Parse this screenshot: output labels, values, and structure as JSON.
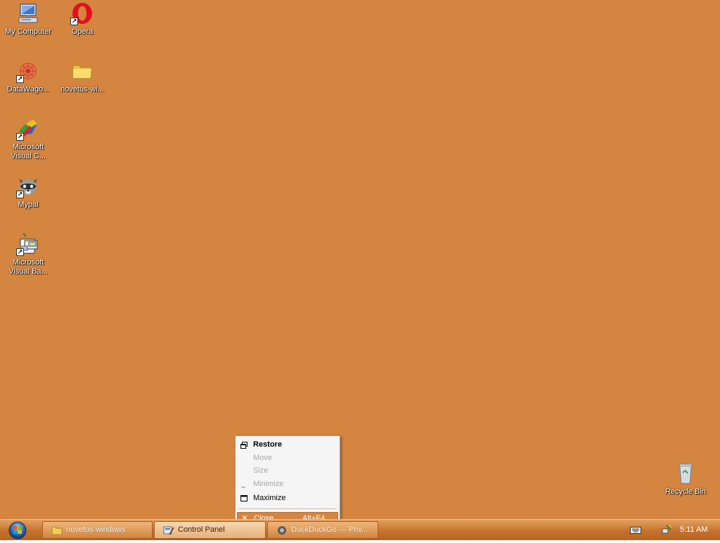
{
  "desktop": {
    "background_color": "#d4853f",
    "icons": [
      {
        "label": "My Computer",
        "icon": "my-computer-icon",
        "shortcut": false
      },
      {
        "label": "Opera",
        "icon": "opera-icon",
        "shortcut": true
      },
      {
        "label": "DataWago...",
        "icon": "datawagon-icon",
        "shortcut": true
      },
      {
        "label": "novetus-wi...",
        "icon": "folder-icon",
        "shortcut": false
      },
      {
        "label": "Microsoft\nVisual C...",
        "icon": "visual-c-icon",
        "shortcut": true
      },
      {
        "label": "Mypal",
        "icon": "mypal-icon",
        "shortcut": true
      },
      {
        "label": "Microsoft\nVisual Ba...",
        "icon": "visual-basic-icon",
        "shortcut": true
      },
      {
        "label": "Recycle Bin",
        "icon": "recycle-bin-icon",
        "shortcut": false
      }
    ]
  },
  "context_menu": {
    "items": [
      {
        "label": "Restore",
        "icon": "restore-icon",
        "enabled": true,
        "bold": true
      },
      {
        "label": "Move",
        "icon": "",
        "enabled": false
      },
      {
        "label": "Size",
        "icon": "",
        "enabled": false
      },
      {
        "label": "Minimize",
        "icon": "minimize-icon",
        "enabled": false
      },
      {
        "label": "Maximize",
        "icon": "maximize-icon",
        "enabled": true
      },
      {
        "label": "Close",
        "shortcut": "Alt+F4",
        "icon": "close-icon",
        "enabled": true,
        "highlighted": true
      }
    ]
  },
  "taskbar": {
    "color": "#c6722c",
    "buttons": [
      {
        "label": "novetus-windows",
        "icon": "folder-icon",
        "active": false
      },
      {
        "label": "Control Panel",
        "icon": "control-panel-icon",
        "active": true
      },
      {
        "label": "DuckDuckGo — Priv...",
        "icon": "browser-icon",
        "active": false
      }
    ],
    "tray": {
      "clock": "5:11 AM",
      "icons": [
        "keyboard-icon",
        "network-icon"
      ]
    }
  }
}
